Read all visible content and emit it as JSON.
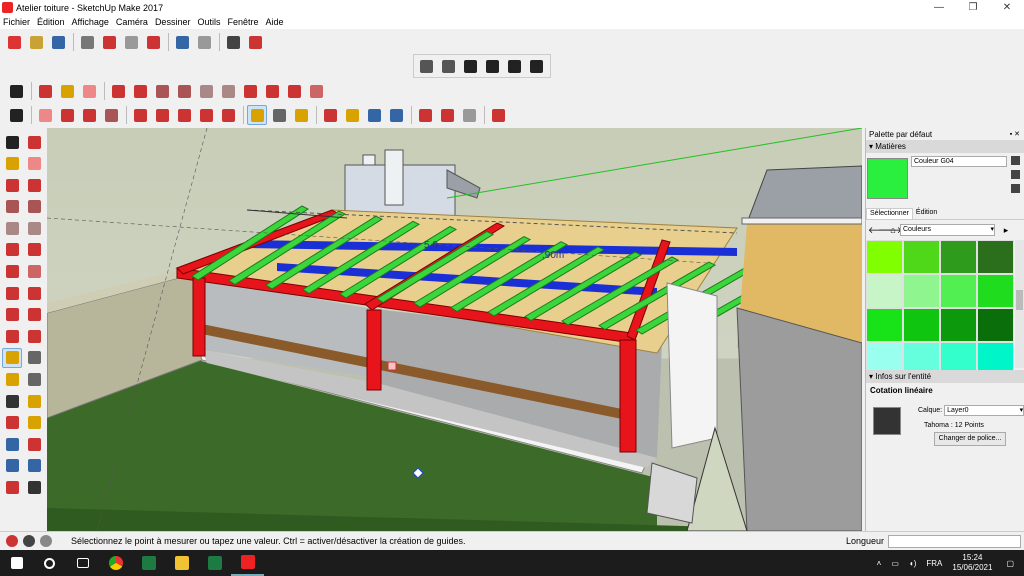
{
  "window": {
    "title": "Atelier toiture - SketchUp Make 2017",
    "controls": [
      "—",
      "❐",
      "✕"
    ]
  },
  "menu": [
    "Fichier",
    "Édition",
    "Affichage",
    "Caméra",
    "Dessiner",
    "Outils",
    "Fenêtre",
    "Aide"
  ],
  "toolbars": {
    "standard": [
      "new-icon",
      "open-icon",
      "save-icon",
      "cut-icon",
      "copy-icon",
      "paste-icon",
      "erase-icon",
      "undo-icon",
      "redo-icon",
      "print-icon",
      "model-info-icon"
    ],
    "views": [
      "iso-view-icon",
      "top-view-icon",
      "front-view-icon",
      "right-view-icon",
      "back-view-icon",
      "left-view-icon"
    ],
    "drawing": [
      "select-icon",
      "make-component-icon",
      "paint-bucket-icon",
      "eraser-icon",
      "line-icon",
      "freehand-icon",
      "rectangle-icon",
      "rotated-rectangle-icon",
      "circle-icon",
      "polygon-icon",
      "arc-icon",
      "2pt-arc-icon",
      "3pt-arc-icon",
      "pie-icon"
    ],
    "large": [
      "select-icon",
      "eraser-icon",
      "pencil-icon",
      "arc-icon",
      "rectangle-icon",
      "push-pull-icon",
      "follow-me-icon",
      "move-icon",
      "rotate-icon",
      "scale-icon",
      "tape-measure-icon",
      "text-icon",
      "paint-bucket-icon",
      "orbit-icon",
      "pan-icon",
      "zoom-icon",
      "zoom-extents-icon",
      "warehouse-icon",
      "extension-icon",
      "share-icon",
      "ruby-icon"
    ],
    "left": [
      "select-icon",
      "make-component-icon",
      "paint-bucket-icon",
      "eraser-icon",
      "line-icon",
      "freehand-icon",
      "rectangle-icon",
      "rotated-rectangle-icon",
      "circle-icon",
      "polygon-icon",
      "arc-icon",
      "2pt-arc-icon",
      "3pt-arc-icon",
      "pie-icon",
      "move-icon",
      "push-pull-icon",
      "rotate-icon",
      "follow-me-icon",
      "scale-icon",
      "offset-icon",
      "tape-measure-icon",
      "dimension-icon",
      "protractor-icon",
      "text-icon",
      "axes-icon",
      "3d-text-icon",
      "orbit-icon",
      "pan-icon",
      "zoom-icon",
      "zoom-window-icon",
      "zoom-extents-icon",
      "previous-view-icon",
      "position-camera-icon",
      "look-around-icon"
    ]
  },
  "viewport": {
    "dimension_labels": [
      "5,0",
      ",90m"
    ]
  },
  "status": {
    "text": "Sélectionnez le point à mesurer ou tapez une valeur.  Ctrl = activer/désactiver la création de guides.",
    "measure_label": "Longueur",
    "measure_value": ""
  },
  "panel": {
    "title": "Palette par défaut",
    "materials_header": "Matières",
    "material_name": "Couleur G04",
    "tab_select": "Sélectionner",
    "tab_edit": "Édition",
    "collection": "Couleurs",
    "swatches": [
      "#7fff00",
      "#4fd81a",
      "#2f9b1c",
      "#2b6e1b",
      "#c8f5c8",
      "#8ff58f",
      "#52ef52",
      "#1fdc1f",
      "#18e318",
      "#10c510",
      "#0c9a0c",
      "#0a6f0a",
      "#99ffee",
      "#66ffdd",
      "#33ffcc",
      "#00f5c8"
    ],
    "entity_header": "Infos sur l'entité",
    "entity_type": "Cotation linéaire",
    "layer_label": "Calque:",
    "layer_value": "Layer0",
    "font_info": "Tahoma : 12 Points",
    "font_button": "Changer de police..."
  },
  "taskbar": {
    "apps": [
      "windows-start-icon",
      "search-icon",
      "task-view-icon",
      "chrome-icon",
      "excel-icon",
      "file-explorer-icon",
      "excel-icon",
      "sketchup-icon"
    ],
    "lang": "FRA",
    "time": "15:24",
    "date": "15/06/2021"
  },
  "colors": {
    "rafter_red": "#e8141c",
    "joist_green": "#3bd63b",
    "beam_blue": "#1a2fd6",
    "osb": "#e8cf8e",
    "grass": "#3c6a28",
    "stone": "#b7b59a"
  }
}
